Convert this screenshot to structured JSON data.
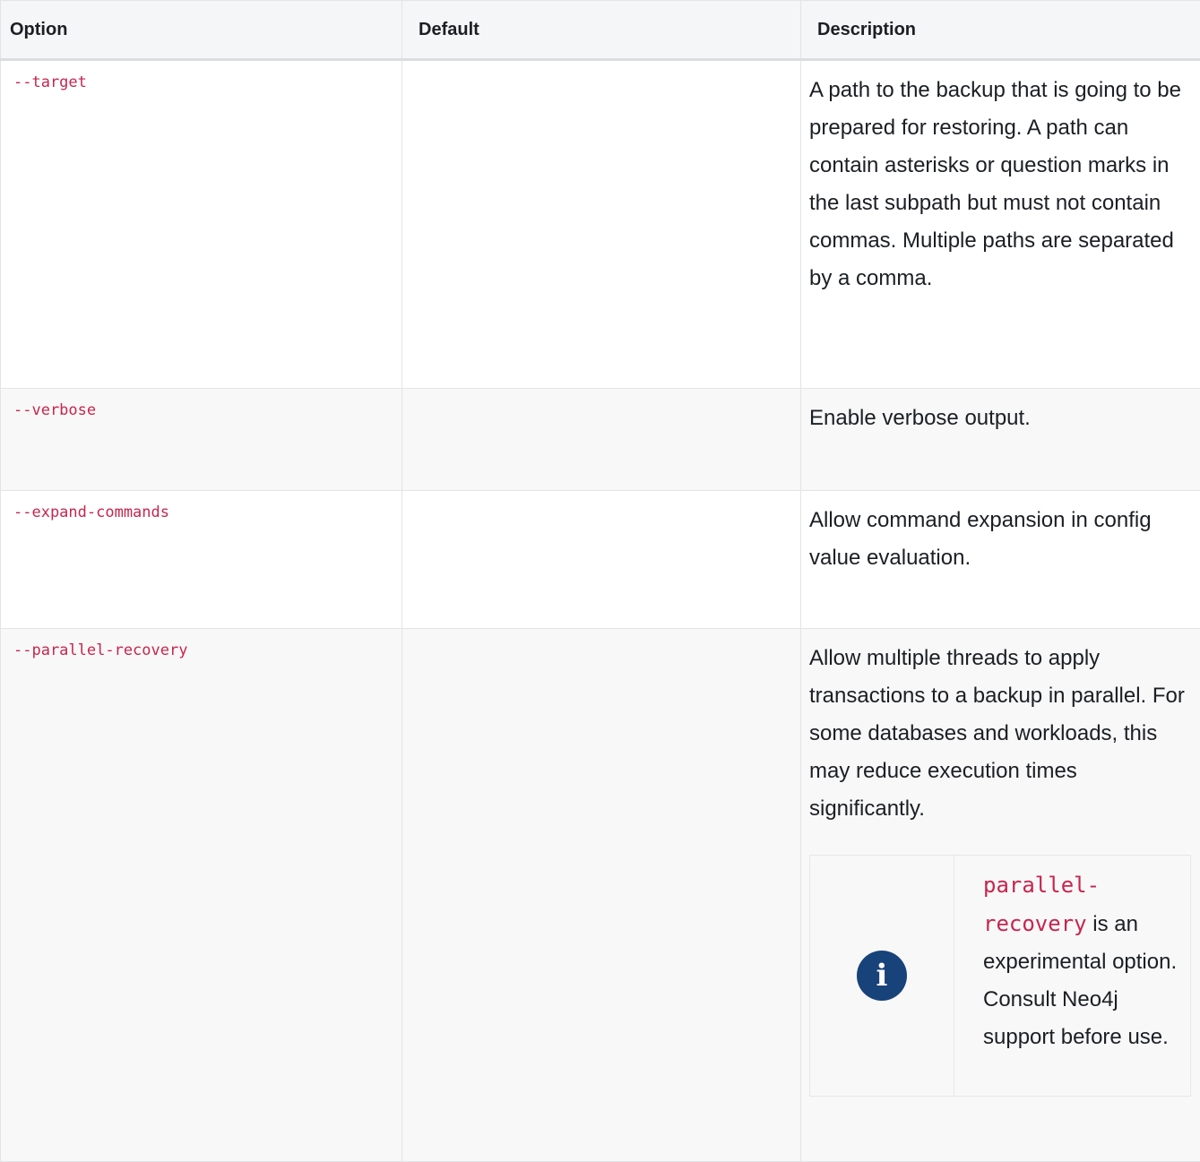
{
  "table": {
    "headers": {
      "option": "Option",
      "default": "Default",
      "description": "Description"
    },
    "rows": [
      {
        "option": "--target",
        "default": "",
        "description": "A path to the backup that is going to be prepared for restoring. A path can contain asterisks or question marks in the last subpath but must not contain commas. Multiple paths are separated by a comma."
      },
      {
        "option": "--verbose",
        "default": "",
        "description": "Enable verbose output."
      },
      {
        "option": "--expand-commands",
        "default": "",
        "description": "Allow command expansion in config value evaluation."
      },
      {
        "option": "--parallel-recovery",
        "default": "",
        "description": "Allow multiple threads to apply transactions to a backup in parallel. For some databases and workloads, this may reduce execution times significantly.",
        "note": {
          "icon": "info-icon",
          "code": "parallel-recovery",
          "text": " is an experimental option. Consult Neo4j support before use."
        }
      }
    ]
  }
}
